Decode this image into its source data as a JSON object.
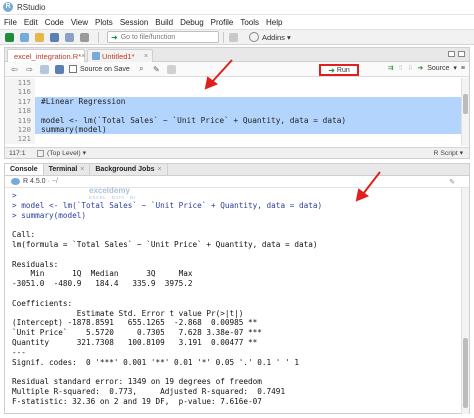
{
  "window": {
    "title": "RStudio"
  },
  "menu": [
    "File",
    "Edit",
    "Code",
    "View",
    "Plots",
    "Session",
    "Build",
    "Debug",
    "Profile",
    "Tools",
    "Help"
  ],
  "toolbar": {
    "goto_placeholder": "Go to file/function",
    "addins_label": "Addins"
  },
  "editor": {
    "tabs": [
      {
        "label": "excel_integration.R*",
        "close": "×"
      },
      {
        "label": "Untitled1*",
        "close": "×"
      }
    ],
    "source_on_save": "Source on Save",
    "run_label": "Run",
    "source_label": "Source",
    "lines": [
      {
        "num": "115",
        "text": "",
        "selected": false
      },
      {
        "num": "116",
        "text": "",
        "selected": false
      },
      {
        "num": "117",
        "text": "#Linear Regression",
        "selected": true
      },
      {
        "num": "118",
        "text": "",
        "selected": true
      },
      {
        "num": "119",
        "text": "model <- lm(`Total Sales` ~ `Unit Price` + Quantity, data = data)",
        "selected": true
      },
      {
        "num": "120",
        "text": "summary(model)",
        "selected": true
      },
      {
        "num": "121",
        "text": "",
        "selected": false
      }
    ],
    "status": {
      "position": "117:1",
      "scope": "(Top Level)",
      "language": "R Script"
    }
  },
  "console": {
    "tabs": [
      "Console",
      "Terminal",
      "Background Jobs"
    ],
    "close": "×",
    "r_version": "R 4.5.0",
    "path": "· ~/",
    "watermark": "exceldemy",
    "watermark_sub": "EXCEL · DATA · BI",
    "lines": [
      {
        "text": ">",
        "cmd": true
      },
      {
        "text": "> model <- lm(`Total Sales` ~ `Unit Price` + Quantity, data = data)",
        "cmd": true
      },
      {
        "text": "> summary(model)",
        "cmd": true
      },
      {
        "text": "",
        "cmd": false
      },
      {
        "text": "Call:",
        "cmd": false
      },
      {
        "text": "lm(formula = `Total Sales` ~ `Unit Price` + Quantity, data = data)",
        "cmd": false
      },
      {
        "text": "",
        "cmd": false
      },
      {
        "text": "Residuals:",
        "cmd": false
      },
      {
        "text": "    Min      1Q  Median      3Q     Max",
        "cmd": false
      },
      {
        "text": "-3051.0  -480.9   184.4   335.9  3975.2",
        "cmd": false
      },
      {
        "text": "",
        "cmd": false
      },
      {
        "text": "Coefficients:",
        "cmd": false
      },
      {
        "text": "              Estimate Std. Error t value Pr(>|t|)",
        "cmd": false
      },
      {
        "text": "(Intercept) -1878.8591   655.1265  -2.868  0.00985 **",
        "cmd": false
      },
      {
        "text": "`Unit Price`    5.5720     0.7305   7.628 3.38e-07 ***",
        "cmd": false
      },
      {
        "text": "Quantity      321.7308   100.8109   3.191  0.00477 **",
        "cmd": false
      },
      {
        "text": "---",
        "cmd": false
      },
      {
        "text": "Signif. codes:  0 '***' 0.001 '**' 0.01 '*' 0.05 '.' 0.1 ' ' 1",
        "cmd": false
      },
      {
        "text": "",
        "cmd": false
      },
      {
        "text": "Residual standard error: 1349 on 19 degrees of freedom",
        "cmd": false
      },
      {
        "text": "Multiple R-squared:  0.773,     Adjusted R-squared:  0.7491",
        "cmd": false
      },
      {
        "text": "F-statistic: 32.36 on 2 and 19 DF,  p-value: 7.616e-07",
        "cmd": false
      }
    ]
  },
  "colors": {
    "selection": "#b3d4fc",
    "annotation": "#e02020",
    "r_blue": "#75aadb"
  }
}
